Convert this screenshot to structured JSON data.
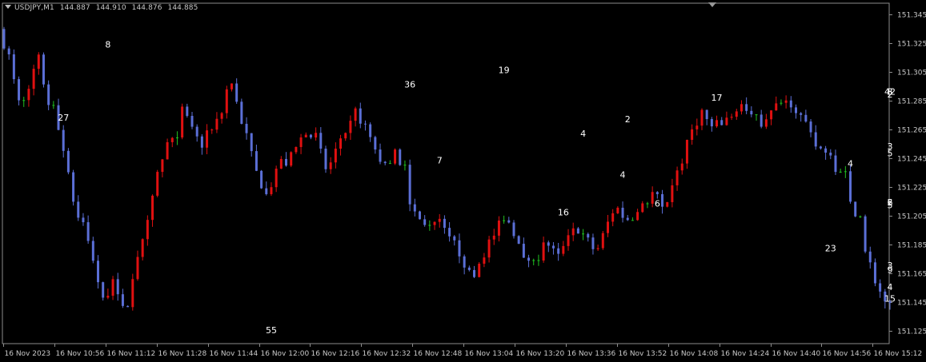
{
  "header": {
    "symbol": "USDJPY,M1",
    "open": "144.887",
    "high": "144.910",
    "low": "144.876",
    "close": "144.885"
  },
  "colors": {
    "background": "#000000",
    "bull": "#e01010",
    "bear": "#5b6fd6",
    "doji": "#20c020",
    "axis_text": "#c8c8c8",
    "frame": "#8c8c8c",
    "annotation": "#ffffff"
  },
  "chart_data": {
    "type": "candlestick",
    "title": "",
    "xlabel": "",
    "ylabel": "",
    "ylim": [
      151.116,
      151.353
    ],
    "y_ticks": [
      "151.345",
      "151.325",
      "151.305",
      "151.285",
      "151.265",
      "151.245",
      "151.225",
      "151.205",
      "151.185",
      "151.165",
      "151.145",
      "151.125"
    ],
    "x_ticks": [
      "16 Nov 2023",
      "16 Nov 10:56",
      "16 Nov 11:12",
      "16 Nov 11:28",
      "16 Nov 11:44",
      "16 Nov 12:00",
      "16 Nov 12:16",
      "16 Nov 12:32",
      "16 Nov 12:48",
      "16 Nov 13:04",
      "16 Nov 13:20",
      "16 Nov 13:36",
      "16 Nov 13:52",
      "16 Nov 14:08",
      "16 Nov 14:24",
      "16 Nov 14:40",
      "16 Nov 14:56",
      "16 Nov 15:12"
    ],
    "price_path": [
      [
        151.34,
        151.33
      ],
      [
        151.325,
        151.308
      ],
      [
        151.295,
        151.27
      ],
      [
        151.282,
        151.295
      ],
      [
        151.32,
        151.315
      ],
      [
        151.29,
        151.282
      ],
      [
        151.275,
        151.265
      ],
      [
        151.245,
        151.24
      ],
      [
        151.215,
        151.195
      ],
      [
        151.205,
        151.185
      ],
      [
        151.17,
        151.16
      ],
      [
        151.155,
        151.14
      ],
      [
        151.16,
        151.165
      ],
      [
        151.132,
        151.138
      ],
      [
        151.162,
        151.165
      ],
      [
        151.185,
        151.2
      ],
      [
        151.22,
        151.23
      ],
      [
        151.245,
        151.25
      ],
      [
        151.26,
        151.265
      ],
      [
        151.27,
        151.285
      ],
      [
        151.262,
        151.275
      ],
      [
        151.254,
        151.25
      ],
      [
        151.265,
        151.268
      ],
      [
        151.273,
        151.278
      ],
      [
        151.3,
        151.305
      ],
      [
        151.28,
        151.27
      ],
      [
        151.258,
        151.25
      ],
      [
        151.235,
        151.222
      ],
      [
        151.215,
        151.23
      ],
      [
        151.24,
        151.245
      ],
      [
        151.244,
        151.24
      ],
      [
        151.25,
        151.258
      ],
      [
        151.265,
        151.268
      ],
      [
        151.262,
        151.255
      ],
      [
        151.24,
        151.23
      ],
      [
        151.248,
        151.255
      ],
      [
        151.258,
        151.26
      ],
      [
        151.275,
        151.28
      ],
      [
        151.27,
        151.265
      ],
      [
        151.255,
        151.25
      ],
      [
        151.24,
        151.238
      ],
      [
        151.255,
        151.25
      ],
      [
        151.233,
        151.222
      ],
      [
        151.215,
        151.205
      ],
      [
        151.195,
        151.198
      ],
      [
        151.205,
        151.2
      ],
      [
        151.208,
        151.2
      ],
      [
        151.19,
        151.185
      ],
      [
        151.18,
        151.175
      ],
      [
        151.168,
        151.155
      ],
      [
        151.17,
        151.18
      ],
      [
        151.185,
        151.19
      ],
      [
        151.198,
        151.2
      ],
      [
        151.205,
        151.195
      ],
      [
        151.19,
        151.185
      ],
      [
        151.175,
        151.168
      ],
      [
        151.185,
        151.2
      ],
      [
        151.19,
        151.18
      ],
      [
        151.178,
        151.172
      ],
      [
        151.185,
        151.19
      ],
      [
        151.195,
        151.2
      ],
      [
        151.192,
        151.185
      ],
      [
        151.175,
        151.183
      ],
      [
        151.193,
        151.2
      ],
      [
        151.21,
        151.215
      ],
      [
        151.205,
        151.2
      ],
      [
        151.203,
        151.205
      ],
      [
        151.21,
        151.215
      ],
      [
        151.22,
        151.225
      ],
      [
        151.21,
        151.205
      ],
      [
        151.225,
        151.235
      ],
      [
        151.24,
        151.25
      ],
      [
        151.262,
        151.27
      ],
      [
        151.275,
        151.28
      ],
      [
        151.27,
        151.262
      ],
      [
        151.268,
        151.272
      ],
      [
        151.272,
        151.278
      ],
      [
        151.285,
        151.28
      ],
      [
        151.275,
        151.272
      ],
      [
        151.268,
        151.27
      ],
      [
        151.275,
        151.278
      ],
      [
        151.28,
        151.283
      ],
      [
        151.285,
        151.288
      ],
      [
        151.28,
        151.275
      ],
      [
        151.265,
        151.262
      ],
      [
        151.255,
        151.248
      ],
      [
        151.255,
        151.248
      ],
      [
        151.24,
        151.235
      ],
      [
        151.225,
        151.218
      ],
      [
        151.205,
        151.198
      ],
      [
        151.185,
        151.175
      ],
      [
        151.165,
        151.155
      ],
      [
        151.145,
        151.14
      ]
    ],
    "annotations": [
      {
        "label": "27",
        "x_index": 6,
        "price": 151.278,
        "pos": "below"
      },
      {
        "label": "8",
        "x_index": 11,
        "price": 151.32,
        "pos": "above"
      },
      {
        "label": "55",
        "x_index": 28,
        "price": 151.13,
        "pos": "below"
      },
      {
        "label": "36",
        "x_index": 42,
        "price": 151.292,
        "pos": "above"
      },
      {
        "label": "7",
        "x_index": 45,
        "price": 151.248,
        "pos": "below"
      },
      {
        "label": "19",
        "x_index": 52,
        "price": 151.302,
        "pos": "above"
      },
      {
        "label": "4",
        "x_index": 60,
        "price": 151.258,
        "pos": "above"
      },
      {
        "label": "16",
        "x_index": 58,
        "price": 151.212,
        "pos": "below"
      },
      {
        "label": "4",
        "x_index": 64,
        "price": 151.238,
        "pos": "below"
      },
      {
        "label": "2",
        "x_index": 65,
        "price": 151.268,
        "pos": "above"
      },
      {
        "label": "6",
        "x_index": 68,
        "price": 151.218,
        "pos": "below"
      },
      {
        "label": "17",
        "x_index": 74,
        "price": 151.283,
        "pos": "above"
      },
      {
        "label": "4",
        "x_index": 88,
        "price": 151.237,
        "pos": "above"
      },
      {
        "label": "23",
        "x_index": 86,
        "price": 151.187,
        "pos": "below"
      },
      {
        "label": "15",
        "x_index": 95,
        "price": 151.152,
        "pos": "below"
      },
      {
        "label": "6",
        "x_index": 100,
        "price": 151.21,
        "pos": "above"
      },
      {
        "label": "2",
        "x_index": 107,
        "price": 151.21,
        "pos": "above"
      },
      {
        "label": "4",
        "x_index": 105,
        "price": 151.16,
        "pos": "below"
      },
      {
        "label": "9",
        "x_index": 111,
        "price": 151.172,
        "pos": "below"
      },
      {
        "label": "5",
        "x_index": 115,
        "price": 151.208,
        "pos": "above"
      },
      {
        "label": "3",
        "x_index": 117,
        "price": 151.175,
        "pos": "below"
      },
      {
        "label": "42",
        "x_index": 142,
        "price": 151.287,
        "pos": "above"
      },
      {
        "label": "5",
        "x_index": 146,
        "price": 151.253,
        "pos": "below"
      },
      {
        "label": "2",
        "x_index": 149,
        "price": 151.285,
        "pos": "above"
      },
      {
        "label": "3",
        "x_index": 151,
        "price": 151.258,
        "pos": "below"
      },
      {
        "label": "8",
        "x_index": 158,
        "price": 151.287,
        "pos": "above"
      }
    ]
  }
}
